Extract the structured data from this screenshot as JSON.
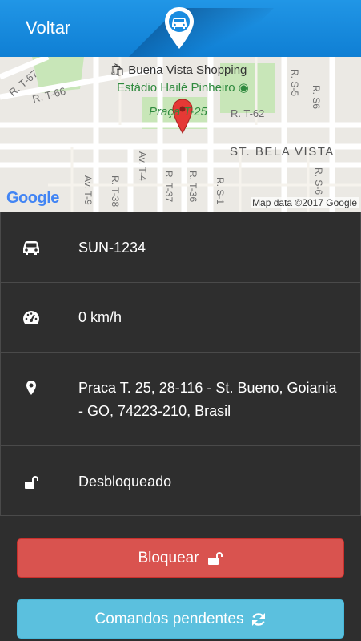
{
  "header": {
    "back_label": "Voltar",
    "logo_icon": "car-location-pin-icon"
  },
  "map": {
    "labels": {
      "shopping": "Buena Vista Shopping",
      "stadium": "Estádio Hailé Pinheiro",
      "praca": "Praça T-25",
      "rt62": "R. T-62",
      "rt66": "R. T-66",
      "rt67": "R. T-67",
      "bela_vista": "ST. BELA VISTA",
      "rs5": "R. S-5",
      "rs6a": "R. S6",
      "rs6b": "R. S-6",
      "avt4": "Av. T-4",
      "rt37": "R. T-37",
      "rt36": "R. T-36",
      "rs1": "R. S-1",
      "avt9": "Av. T-9",
      "rt38": "R. T-38"
    },
    "google": "Google",
    "attribution": "Map data ©2017 Google"
  },
  "vehicle": {
    "plate": "SUN-1234",
    "speed": "0 km/h",
    "address": "Praca T. 25, 28-116 - St. Bueno, Goiania - GO, 74223-210, Brasil",
    "status": "Desbloqueado"
  },
  "buttons": {
    "lock_label": "Bloquear",
    "pending_label": "Comandos pendentes"
  },
  "colors": {
    "header": "#1a8ce0",
    "lock": "#d9534f",
    "pending": "#5bc0de",
    "background": "#2e2e2e"
  }
}
